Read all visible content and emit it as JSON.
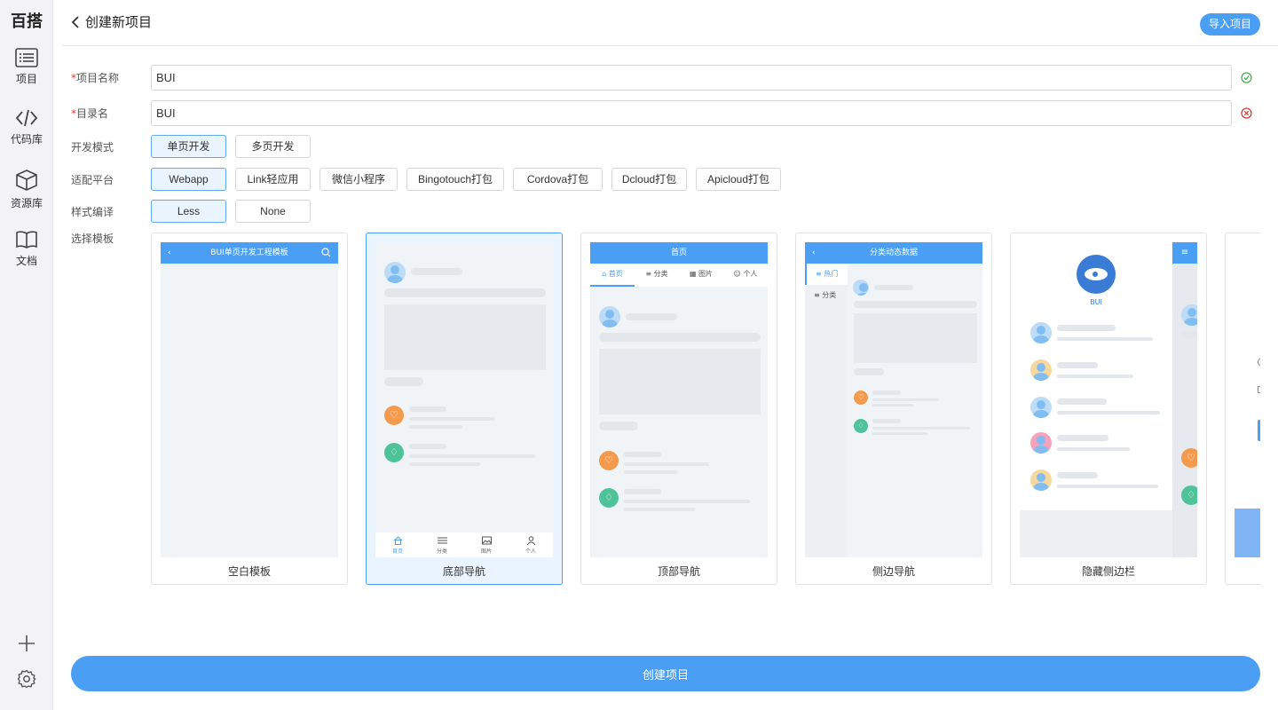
{
  "app": {
    "brand": "百搭"
  },
  "sidebar": {
    "items": [
      {
        "label": "项目",
        "icon": "list-icon"
      },
      {
        "label": "代码库",
        "icon": "code-icon"
      },
      {
        "label": "资源库",
        "icon": "cube-icon"
      },
      {
        "label": "文档",
        "icon": "book-icon"
      }
    ],
    "bottom": [
      {
        "icon": "plus-icon"
      },
      {
        "icon": "gear-icon"
      }
    ]
  },
  "header": {
    "title": "创建新项目",
    "import_label": "导入项目"
  },
  "form": {
    "project_name": {
      "label": "项目名称",
      "required_mark": "*",
      "value": "BUI",
      "status": "valid"
    },
    "dir_name": {
      "label": "目录名",
      "required_mark": "*",
      "value": "BUI",
      "status": "invalid"
    },
    "dev_mode": {
      "label": "开发模式",
      "options": [
        "单页开发",
        "多页开发"
      ],
      "selected": "单页开发"
    },
    "platform": {
      "label": "适配平台",
      "options": [
        "Webapp",
        "Link轻应用",
        "微信小程序",
        "Bingotouch打包",
        "Cordova打包",
        "Dcloud打包",
        "Apicloud打包"
      ],
      "selected": "Webapp"
    },
    "style": {
      "label": "样式编译",
      "options": [
        "Less",
        "None"
      ],
      "selected": "Less"
    },
    "template_label": "选择模板"
  },
  "templates": [
    {
      "name": "空白模板",
      "header": "BUI单页开发工程模板"
    },
    {
      "name": "底部导航",
      "tabs": [
        "首页",
        "分类",
        "图片",
        "个人"
      ]
    },
    {
      "name": "顶部导航",
      "header": "首页",
      "tabs": [
        "首页",
        "分类",
        "图片",
        "个人"
      ]
    },
    {
      "name": "侧边导航",
      "header": "分类动态数据",
      "side": [
        "热门",
        "分类"
      ]
    },
    {
      "name": "隐藏侧边栏",
      "logo_text": "BUI"
    }
  ],
  "selected_template": "底部导航",
  "create_label": "创建项目",
  "colors": {
    "accent": "#4a9ff5",
    "selected_bg": "#eaf4fe",
    "valid": "#4caf50",
    "invalid": "#e53935"
  }
}
